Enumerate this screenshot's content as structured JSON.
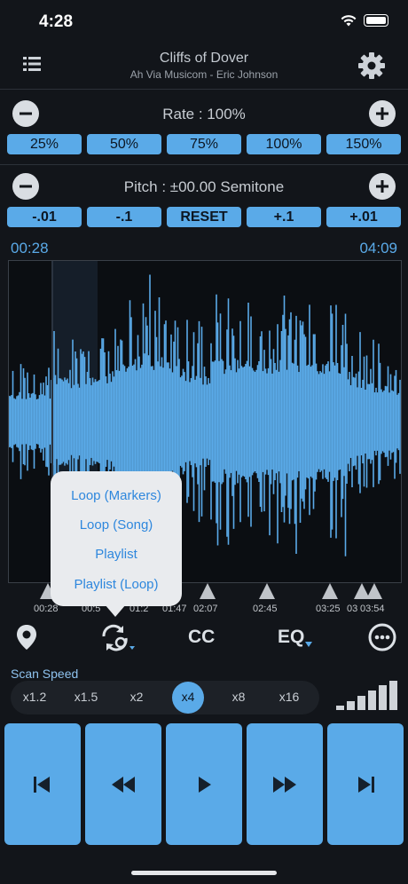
{
  "status": {
    "time": "4:28"
  },
  "header": {
    "title": "Cliffs of Dover",
    "subtitle": "Ah Via Musicom - Eric Johnson"
  },
  "rate": {
    "label": "Rate : 100%",
    "presets": [
      "25%",
      "50%",
      "75%",
      "100%",
      "150%"
    ]
  },
  "pitch": {
    "label": "Pitch : ±00.00 Semitone",
    "presets": [
      "-.01",
      "-.1",
      "RESET",
      "+.1",
      "+.01"
    ]
  },
  "playback": {
    "current_time": "00:28",
    "total_time": "04:09"
  },
  "markers": {
    "labels": [
      "00:28",
      "00:5",
      "01:2",
      "01:47",
      "02:07",
      "02:45",
      "03:25",
      "03",
      "03:54"
    ]
  },
  "loop_menu": {
    "items": [
      "Loop (Markers)",
      "Loop (Song)",
      "Playlist",
      "Playlist (Loop)"
    ]
  },
  "toolbar": {
    "cc_label": "CC",
    "eq_label": "EQ"
  },
  "scan": {
    "label": "Scan Speed",
    "options": [
      "x1.2",
      "x1.5",
      "x2",
      "x4",
      "x8",
      "x16"
    ],
    "selected": "x4"
  },
  "colors": {
    "accent": "#5aaae8",
    "background": "#12151a",
    "popup_text": "#2e87dd"
  }
}
